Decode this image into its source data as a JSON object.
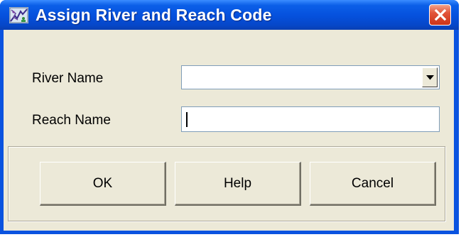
{
  "window": {
    "title": "Assign River and Reach Code",
    "icon": "app-map-icon",
    "close_icon": "close-icon"
  },
  "form": {
    "river_label": "River Name",
    "river_value": "",
    "reach_label": "Reach Name",
    "reach_value": ""
  },
  "buttons": {
    "ok": "OK",
    "help": "Help",
    "cancel": "Cancel"
  },
  "colors": {
    "titlebar": "#0550dc",
    "client": "#ece9d8",
    "close_button": "#e2543a"
  }
}
